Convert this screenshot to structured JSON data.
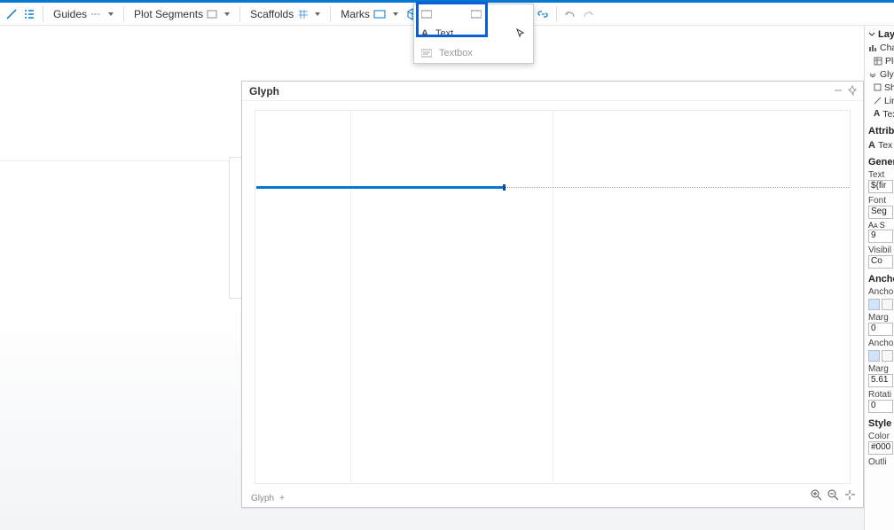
{
  "toolbar": {
    "guides": "Guides",
    "plot_segments": "Plot Segments",
    "scaffolds": "Scaffolds",
    "marks": "Marks"
  },
  "popup": {
    "row1a": "",
    "row1b": "",
    "row2_label": "Text",
    "row3_label": "Textbox"
  },
  "glyph": {
    "title": "Glyph",
    "footer": "Glyph",
    "plus": "+"
  },
  "sidebar": {
    "layers_title": "Layers",
    "chart": "Chart",
    "plot": "Plo",
    "glyph": "Glyph",
    "sh": "Sh",
    "lin": "Lin",
    "tex": "Tex",
    "attrib_title": "Attrib",
    "attrib_item": "Tex",
    "general_title": "Gener",
    "text_label": "Text",
    "text_value": "${fir",
    "font_label": "Font",
    "font_value": "Seg",
    "size_value": "9",
    "size_extra": "S",
    "visibility_label": "Visibil",
    "visibility_value": "Co",
    "anchor1_title": "Ancho",
    "anchor1_label": "Ancho",
    "margin1_label": "Marg",
    "margin1_value": "0",
    "anchor2_label": "Ancho",
    "margin2_label": "Marg",
    "margin2_value": "5.61",
    "rotation_label": "Rotati",
    "rotation_value": "0",
    "style_title": "Style",
    "color_label": "Color",
    "color_value": "#000",
    "outline_label": "Outli"
  }
}
